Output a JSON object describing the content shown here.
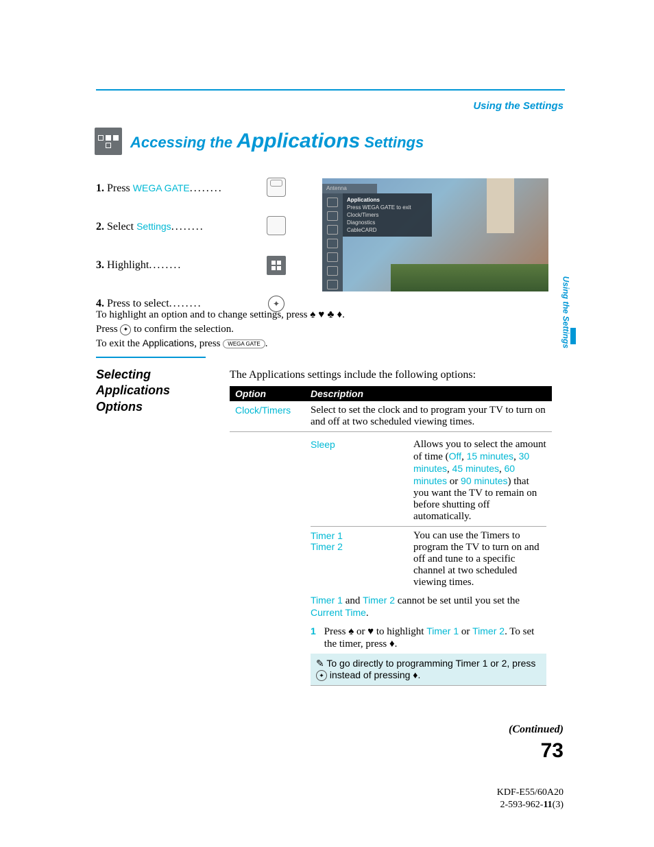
{
  "header": {
    "section_label": "Using the Settings",
    "title_prefix": "Accessing the ",
    "title_main": "Applications",
    "title_suffix": " Settings"
  },
  "steps": [
    {
      "num": "1.",
      "verb": "Press ",
      "keyword": "WEGA GATE"
    },
    {
      "num": "2.",
      "verb": "Select ",
      "keyword": "Settings"
    },
    {
      "num": "3.",
      "verb": "Highlight",
      "keyword": ""
    },
    {
      "num": "4.",
      "verb": "Press to select",
      "keyword": ""
    }
  ],
  "tv_menu": {
    "top_bar": "Antenna",
    "panel_title": "Applications",
    "panel_sub": "Press WEGA GATE to exit",
    "items": [
      "Clock/Timers",
      "Diagnostics",
      "CableCARD"
    ]
  },
  "instructions": {
    "line1_pre": "To highlight an option and to change settings, press ",
    "line1_arrows": "♠ ♦ ♣ ♥",
    "line2_pre": "Press ",
    "line2_post": " to confirm the selection.",
    "line3_pre": "To exit the ",
    "line3_app": "Applications",
    "line3_mid": ", press ",
    "line3_post": "."
  },
  "section": {
    "heading": "Selecting Applications Options",
    "intro": "The Applications settings include the following options:"
  },
  "table": {
    "head_option": "Option",
    "head_desc": "Description",
    "clock_label": "Clock/Timers",
    "clock_desc": "Select to set the clock and to program your TV to turn on and off at two scheduled viewing times.",
    "sleep_label": "Sleep",
    "sleep_desc_pre": "Allows you to select the amount of time (",
    "sleep_opts": [
      "Off",
      "15 minutes",
      "30 minutes",
      "45 minutes",
      "60 minutes",
      "90 minutes"
    ],
    "sleep_or": " or ",
    "sleep_desc_post": ") that you want the TV to remain on before shutting off automatically.",
    "timer1_label": "Timer 1",
    "timer2_label": "Timer 2",
    "timer_desc": "You can use the Timers to program the TV to turn on and off and tune to a specific channel at two scheduled viewing times.",
    "note_t1": "Timer 1",
    "note_and": " and ",
    "note_t2": "Timer 2",
    "note_mid": " cannot be set until you set the ",
    "note_ct": "Current Time",
    "note_end": ".",
    "step1_num": "1",
    "step1_pre": "Press ",
    "step1_mid": " or ",
    "step1_mid2": " to highlight ",
    "step1_or": " or ",
    "step1_post": ". To set the timer, press ",
    "step1_end": ".",
    "tip_pre": "To go directly to programming ",
    "tip_t1": "Timer 1",
    "tip_or": " or ",
    "tip_t2": "2",
    "tip_mid": ", press ",
    "tip_post": " instead of pressing ",
    "tip_end": "."
  },
  "sidebar_tab": "Using the Settings",
  "continued": "(Continued)",
  "page_number": "73",
  "footer": {
    "model": "KDF-E55/60A20",
    "doc_pre": "2-593-962-",
    "doc_bold": "11",
    "doc_post": "(3)"
  }
}
